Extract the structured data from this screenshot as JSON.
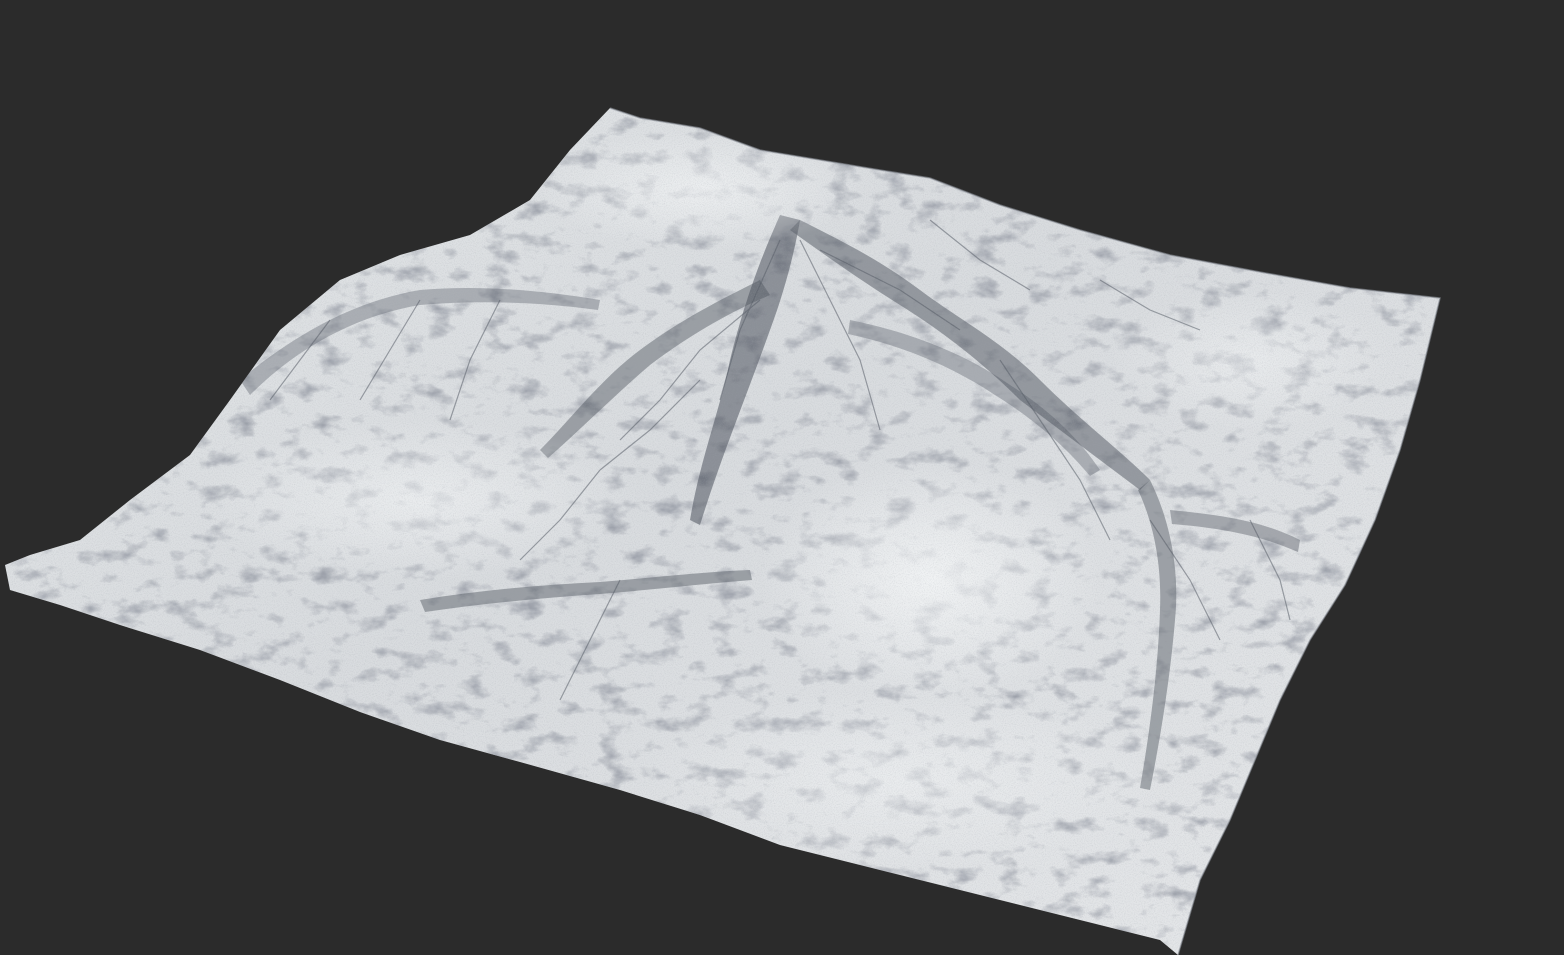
{
  "scene": {
    "background_color": "#2b2b2b",
    "terrain_base_color": "#dcdfe2",
    "terrain_shadow_color": "#3a3f48",
    "terrain_highlight_color": "#f2f4f5",
    "subject": "heightmap-terrain-render"
  }
}
